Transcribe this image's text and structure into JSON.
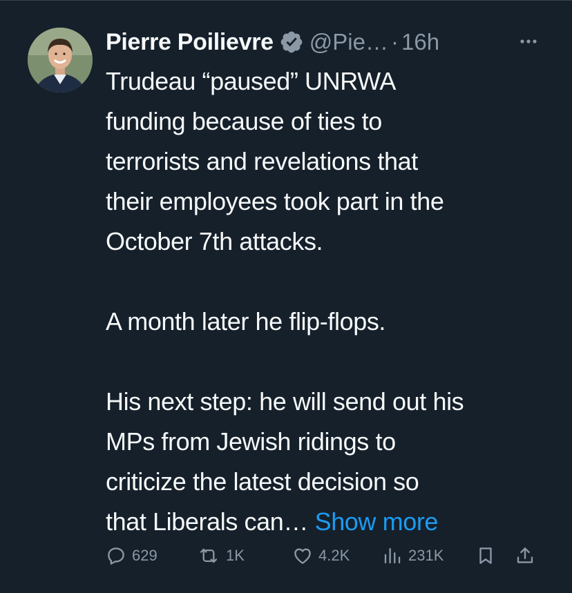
{
  "tweet": {
    "author": {
      "display_name": "Pierre Poilievre",
      "handle": "@Pie…",
      "verified": true
    },
    "separator": "·",
    "time": "16h",
    "body": "Trudeau “paused” UNRWA\nfunding because of ties to\nterrorists and revelations that\ntheir employees took part in the\nOctober 7th attacks.\n\nA month later he flip-flops.\n\nHis next step: he will send out his\nMPs from Jewish ridings to\ncriticize the latest decision so\nthat Liberals can…",
    "show_more": "Show more",
    "stats": {
      "replies": "629",
      "retweets": "1K",
      "likes": "4.2K",
      "views": "231K"
    }
  },
  "colors": {
    "background": "#15202b",
    "text": "#f7f9f9",
    "muted": "#8b98a5",
    "link": "#1d9bf0"
  },
  "icons": [
    "more-icon",
    "verified-icon",
    "reply-icon",
    "retweet-icon",
    "like-icon",
    "views-icon",
    "bookmark-icon",
    "share-icon"
  ]
}
